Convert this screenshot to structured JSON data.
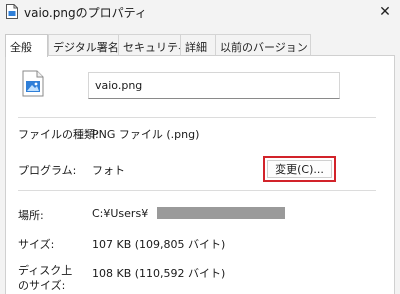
{
  "window": {
    "title": "vaio.pngのプロパティ",
    "close_glyph": "✕"
  },
  "tabs": [
    {
      "label": "全般"
    },
    {
      "label": "デジタル署名"
    },
    {
      "label": "セキュリティ"
    },
    {
      "label": "詳細"
    },
    {
      "label": "以前のバージョン"
    }
  ],
  "general": {
    "file_name": "vaio.png",
    "file_type_label": "ファイルの種類:",
    "file_type_value": "PNG ファイル (.png)",
    "program_label": "プログラム:",
    "program_value": "フォト",
    "change_button": "変更(C)...",
    "location_label": "場所:",
    "location_value": "C:¥Users¥",
    "size_label": "サイズ:",
    "size_value": "107 KB (109,805 バイト)",
    "disk_size_label_1": "ディスク上",
    "disk_size_label_2": "のサイズ:",
    "disk_size_value": "108 KB (110,592 バイト)"
  },
  "colors": {
    "highlight": "#d2232a",
    "icon_blue": "#2f7fd8"
  }
}
